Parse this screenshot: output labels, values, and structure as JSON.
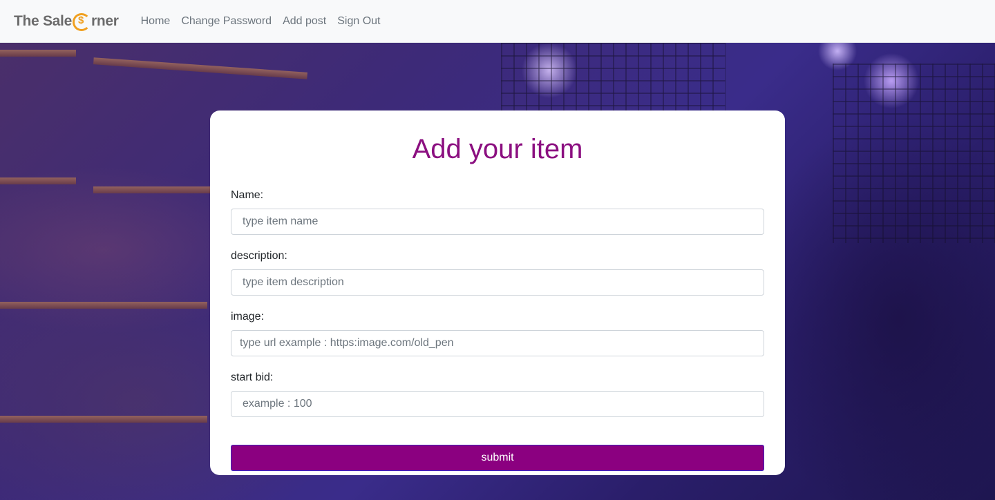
{
  "navbar": {
    "brand": {
      "prefix": "The Sale",
      "suffix": "rner",
      "logo_icon": "coin-c-icon"
    },
    "links": [
      {
        "label": "Home"
      },
      {
        "label": "Change Password"
      },
      {
        "label": "Add post"
      },
      {
        "label": "Sign Out"
      }
    ]
  },
  "form": {
    "title": "Add your item",
    "fields": [
      {
        "label": "Name:",
        "placeholder": "type item name",
        "value": ""
      },
      {
        "label": "description:",
        "placeholder": "type item description",
        "value": ""
      },
      {
        "label": "image:",
        "placeholder": "type url example : https:image.com/old_pen",
        "value": ""
      },
      {
        "label": "start bid:",
        "placeholder": "example : 100",
        "value": ""
      }
    ],
    "submit_label": "submit"
  },
  "colors": {
    "title": "#8b0f80",
    "submit_bg": "#8b0080",
    "submit_border": "#3a23c4",
    "navbar_bg": "#f8f9fa",
    "brand_accent": "#f0a020"
  }
}
